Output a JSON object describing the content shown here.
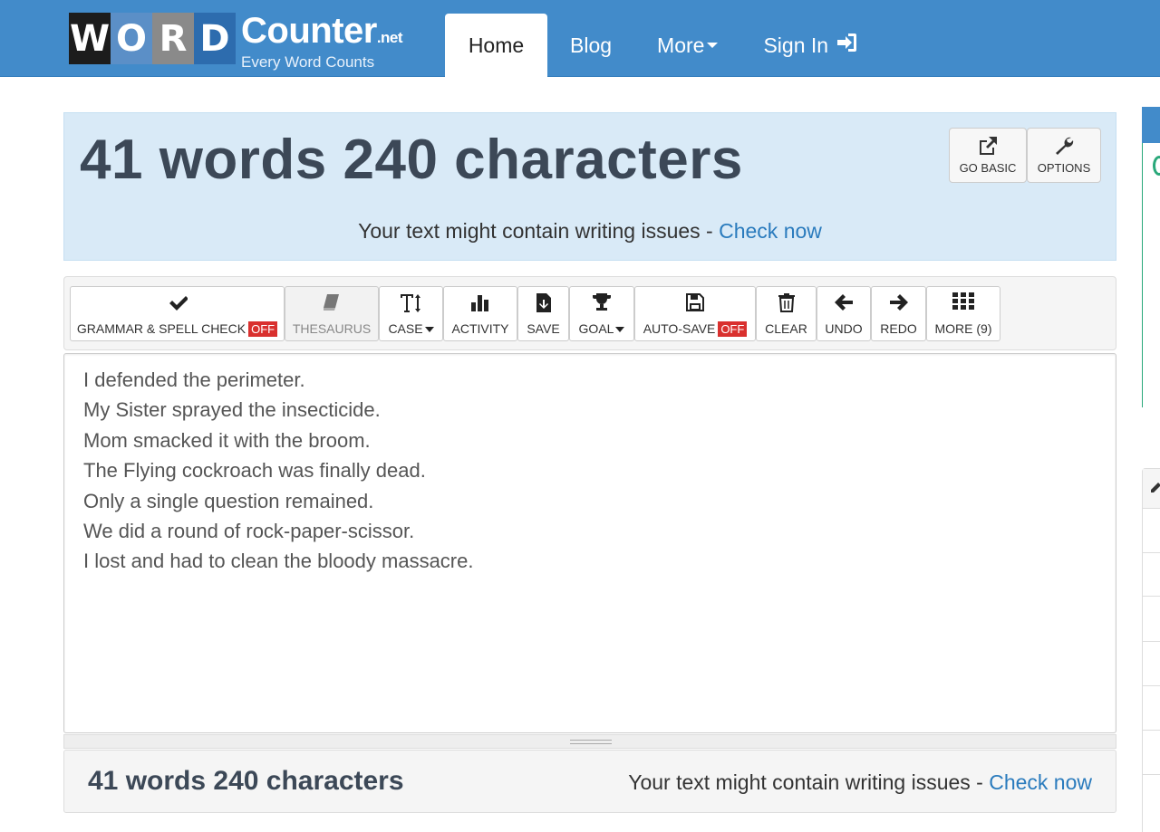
{
  "brand": {
    "tiles": [
      "W",
      "O",
      "R",
      "D"
    ],
    "name": "Counter",
    "tld": ".net",
    "tagline": "Every Word Counts"
  },
  "nav": {
    "home": "Home",
    "blog": "Blog",
    "more": "More",
    "signin": "Sign In"
  },
  "header": {
    "count": "41 words 240 characters",
    "go_basic": "GO BASIC",
    "options": "OPTIONS",
    "issues_text": "Your text might contain writing issues - ",
    "issues_link": "Check now"
  },
  "toolbar": {
    "grammar": "GRAMMAR & SPELL CHECK",
    "grammar_state": "OFF",
    "thesaurus": "THESAURUS",
    "case": "CASE",
    "activity": "ACTIVITY",
    "save": "SAVE",
    "goal": "GOAL",
    "autosave": "AUTO-SAVE",
    "autosave_state": "OFF",
    "clear": "CLEAR",
    "undo": "UNDO",
    "redo": "REDO",
    "more": "MORE (9)"
  },
  "editor": {
    "lines": [
      "I defended the perimeter.",
      "My Sister sprayed the insecticide.",
      "Mom smacked it with the broom.",
      "The Flying cockroach was finally dead.",
      "Only a single question remained.",
      "We did a round of rock-paper-scissor.",
      "I lost and had to clean the bloody massacre."
    ]
  },
  "footer": {
    "count": "41 words 240 characters",
    "issues_text": "Your text might contain writing issues - ",
    "issues_link": "Check now"
  },
  "icons": {
    "signin": "sign-in-icon",
    "go_basic": "external-link-icon",
    "options": "wrench-icon",
    "grammar": "check-icon",
    "thesaurus": "book-icon",
    "case": "text-height-icon",
    "activity": "bar-chart-icon",
    "save": "file-download-icon",
    "goal": "trophy-icon",
    "autosave": "floppy-disk-icon",
    "clear": "trash-icon",
    "undo": "arrow-left-icon",
    "redo": "arrow-right-icon",
    "more": "grid-icon"
  },
  "colors": {
    "navbar": "#428bca",
    "header_panel": "#d9eaf7",
    "link": "#2a7bbd",
    "off_badge": "#d9302e",
    "count_text": "#3c4857"
  }
}
